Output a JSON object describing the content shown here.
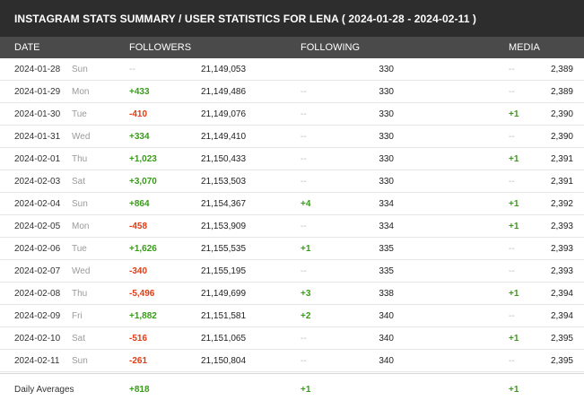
{
  "title": "INSTAGRAM STATS SUMMARY / USER STATISTICS FOR LENA ( 2024-01-28 - 2024-02-11 )",
  "headers": {
    "date": "DATE",
    "followers": "FOLLOWERS",
    "following": "FOLLOWING",
    "media": "MEDIA"
  },
  "rows": [
    {
      "date": "2024-01-28",
      "day": "Sun",
      "followers_delta": "--",
      "followers": "21,149,053",
      "following_delta": "",
      "following": "330",
      "media_delta": "--",
      "media": "2,389"
    },
    {
      "date": "2024-01-29",
      "day": "Mon",
      "followers_delta": "+433",
      "followers": "21,149,486",
      "following_delta": "--",
      "following": "330",
      "media_delta": "--",
      "media": "2,389"
    },
    {
      "date": "2024-01-30",
      "day": "Tue",
      "followers_delta": "-410",
      "followers": "21,149,076",
      "following_delta": "--",
      "following": "330",
      "media_delta": "+1",
      "media": "2,390"
    },
    {
      "date": "2024-01-31",
      "day": "Wed",
      "followers_delta": "+334",
      "followers": "21,149,410",
      "following_delta": "--",
      "following": "330",
      "media_delta": "--",
      "media": "2,390"
    },
    {
      "date": "2024-02-01",
      "day": "Thu",
      "followers_delta": "+1,023",
      "followers": "21,150,433",
      "following_delta": "--",
      "following": "330",
      "media_delta": "+1",
      "media": "2,391"
    },
    {
      "date": "2024-02-03",
      "day": "Sat",
      "followers_delta": "+3,070",
      "followers": "21,153,503",
      "following_delta": "--",
      "following": "330",
      "media_delta": "--",
      "media": "2,391"
    },
    {
      "date": "2024-02-04",
      "day": "Sun",
      "followers_delta": "+864",
      "followers": "21,154,367",
      "following_delta": "+4",
      "following": "334",
      "media_delta": "+1",
      "media": "2,392"
    },
    {
      "date": "2024-02-05",
      "day": "Mon",
      "followers_delta": "-458",
      "followers": "21,153,909",
      "following_delta": "--",
      "following": "334",
      "media_delta": "+1",
      "media": "2,393"
    },
    {
      "date": "2024-02-06",
      "day": "Tue",
      "followers_delta": "+1,626",
      "followers": "21,155,535",
      "following_delta": "+1",
      "following": "335",
      "media_delta": "--",
      "media": "2,393"
    },
    {
      "date": "2024-02-07",
      "day": "Wed",
      "followers_delta": "-340",
      "followers": "21,155,195",
      "following_delta": "--",
      "following": "335",
      "media_delta": "--",
      "media": "2,393"
    },
    {
      "date": "2024-02-08",
      "day": "Thu",
      "followers_delta": "-5,496",
      "followers": "21,149,699",
      "following_delta": "+3",
      "following": "338",
      "media_delta": "+1",
      "media": "2,394"
    },
    {
      "date": "2024-02-09",
      "day": "Fri",
      "followers_delta": "+1,882",
      "followers": "21,151,581",
      "following_delta": "+2",
      "following": "340",
      "media_delta": "--",
      "media": "2,394"
    },
    {
      "date": "2024-02-10",
      "day": "Sat",
      "followers_delta": "-516",
      "followers": "21,151,065",
      "following_delta": "--",
      "following": "340",
      "media_delta": "+1",
      "media": "2,395"
    },
    {
      "date": "2024-02-11",
      "day": "Sun",
      "followers_delta": "-261",
      "followers": "21,150,804",
      "following_delta": "--",
      "following": "340",
      "media_delta": "--",
      "media": "2,395"
    }
  ],
  "averages": {
    "label": "Daily Averages",
    "followers": "+818",
    "following": "+1",
    "media": "+1"
  },
  "colors": {
    "title_bg": "#2d2d2d",
    "header_bg": "#4a4a4a",
    "positive": "#3a9b1a",
    "negative": "#e23c14",
    "neutral": "#b8b8b8"
  }
}
